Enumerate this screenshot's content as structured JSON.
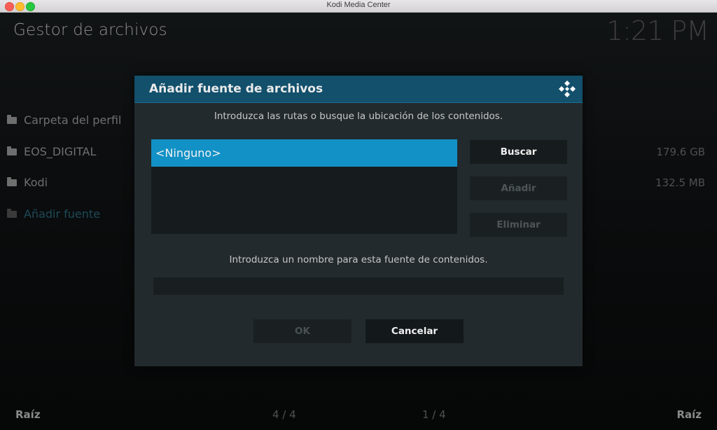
{
  "window": {
    "title": "Kodi Media Center"
  },
  "background": {
    "title": "Gestor de archivos",
    "clock": "1:21 PM",
    "items": [
      {
        "label": "Carpeta del perfil",
        "size": ""
      },
      {
        "label": "EOS_DIGITAL",
        "size": "179.6 GB"
      },
      {
        "label": "Kodi",
        "size": "132.5 MB"
      },
      {
        "label": "Añadir fuente",
        "size": ""
      }
    ],
    "footer": {
      "left": "Raíz",
      "mid1": "4 / 4",
      "mid2": "1 / 4",
      "right": "Raíz"
    }
  },
  "dialog": {
    "title": "Añadir fuente de archivos",
    "instruction_paths": "Introduzca las rutas o busque la ubicación de los contenidos.",
    "paths": [
      "<Ninguno>"
    ],
    "buttons": {
      "browse": "Buscar",
      "add": "Añadir",
      "remove": "Eliminar"
    },
    "instruction_name": "Introduzca un nombre para esta fuente de contenidos.",
    "name_value": "",
    "ok": "OK",
    "cancel": "Cancelar"
  },
  "colors": {
    "accent": "#1291c6",
    "header": "#12506c",
    "dialog_bg": "#232a2d"
  },
  "icons": [
    "folder-icon",
    "kodi-logo-icon"
  ]
}
